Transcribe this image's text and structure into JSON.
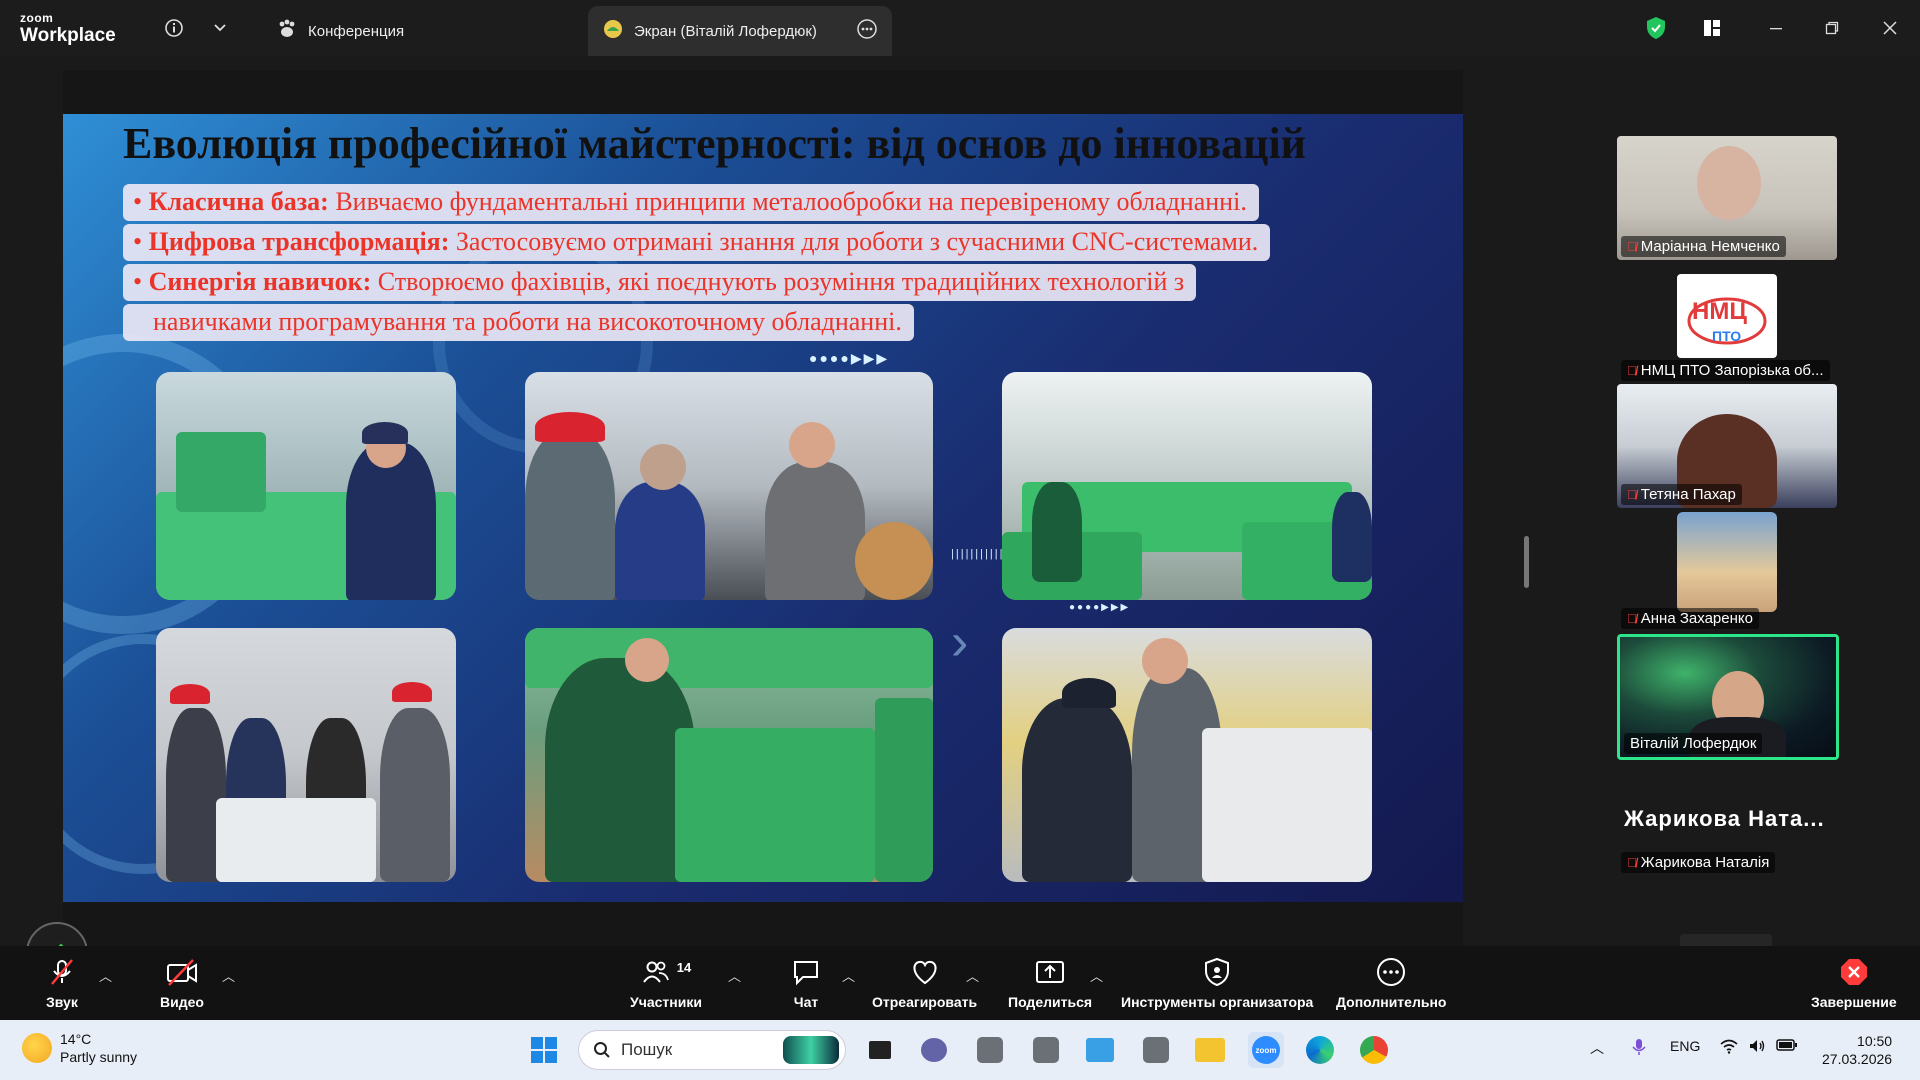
{
  "app": {
    "logo_line1": "zoom",
    "logo_line2": "Workplace"
  },
  "tabs": [
    {
      "label": "Конференция"
    },
    {
      "label": "Экран (Віталій Лофердюк)"
    }
  ],
  "slide": {
    "title": "Еволюція професійної майстерності: від основ до інновацій",
    "bullets": [
      {
        "term": "Класична база:",
        "text": " Вивчаємо фундаментальні принципи металообробки на перевіреному обладнанні."
      },
      {
        "term": "Цифрова трансформація:",
        "text": " Застосовуємо отримані знання для роботи з сучасними CNC-системами."
      },
      {
        "term": "Синергія навичок:",
        "text": " Створюємо фахівців, які поєднують розуміння традиційних технологій з"
      },
      {
        "term": "",
        "text": "навичками програмування та роботи на високоточному обладнанні."
      }
    ]
  },
  "participants": [
    {
      "name": "Маріанна Немченко",
      "muted": true
    },
    {
      "name": "НМЦ ПТО Запорізька об...",
      "muted": true
    },
    {
      "name": "Тетяна Пахар",
      "muted": true
    },
    {
      "name": "Анна Захаренко",
      "muted": true
    },
    {
      "name": "Віталій Лофердюк",
      "muted": false,
      "active_speaker": true
    },
    {
      "name": "Жарикова Наталія",
      "muted": true
    }
  ],
  "big_name": "Жарикова Ната...",
  "toolbar": {
    "audio": "Звук",
    "video": "Видео",
    "participants": "Участники",
    "participants_count": "14",
    "chat": "Чат",
    "react": "Отреагировать",
    "share": "Поделиться",
    "host_tools": "Инструменты организатора",
    "more": "Дополнительно",
    "end": "Завершение"
  },
  "taskbar": {
    "weather_temp": "14°C",
    "weather_desc": "Partly sunny",
    "search_placeholder": "Пошук",
    "lang": "ENG",
    "time": "10:50",
    "date": "27.03.2026"
  },
  "colors": {
    "slide_bullet_text": "#ec3327",
    "active_speaker_border": "#2ee68a",
    "shield_green": "#22c55e",
    "end_red": "#ff3b3b"
  }
}
